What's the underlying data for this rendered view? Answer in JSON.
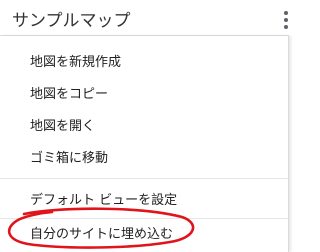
{
  "header": {
    "title": "サンプルマップ",
    "more_icon": "more-vert-icon"
  },
  "menu": {
    "items": [
      {
        "label": "地図を新規作成"
      },
      {
        "label": "地図をコピー"
      },
      {
        "label": "地図を開く"
      },
      {
        "label": "ゴミ箱に移動"
      },
      {
        "label": "デフォルト ビューを設定"
      },
      {
        "label": "自分のサイトに埋め込む"
      }
    ]
  },
  "annotation": {
    "highlight_color": "#e0141b"
  }
}
